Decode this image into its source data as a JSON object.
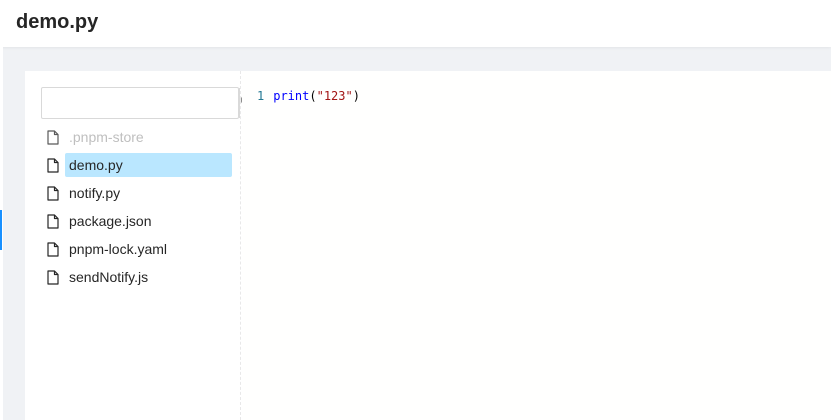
{
  "header": {
    "title": "demo.py"
  },
  "search": {
    "value": "",
    "placeholder": "",
    "icon": "search-icon"
  },
  "files": [
    {
      "name": ".pnpm-store",
      "state": "disabled"
    },
    {
      "name": "demo.py",
      "state": "selected"
    },
    {
      "name": "notify.py",
      "state": "normal"
    },
    {
      "name": "package.json",
      "state": "normal"
    },
    {
      "name": "pnpm-lock.yaml",
      "state": "normal"
    },
    {
      "name": "sendNotify.js",
      "state": "normal"
    }
  ],
  "editor": {
    "lines": [
      {
        "number": "1",
        "fn": "print",
        "open": "(",
        "string": "\"123\"",
        "close": ")"
      }
    ]
  },
  "colors": {
    "accent": "#1890ff",
    "selected_bg": "#bae7ff",
    "disabled_text": "#bfbfbf",
    "code_fn": "#0000ff",
    "code_string": "#a31515",
    "line_number": "#237893"
  }
}
